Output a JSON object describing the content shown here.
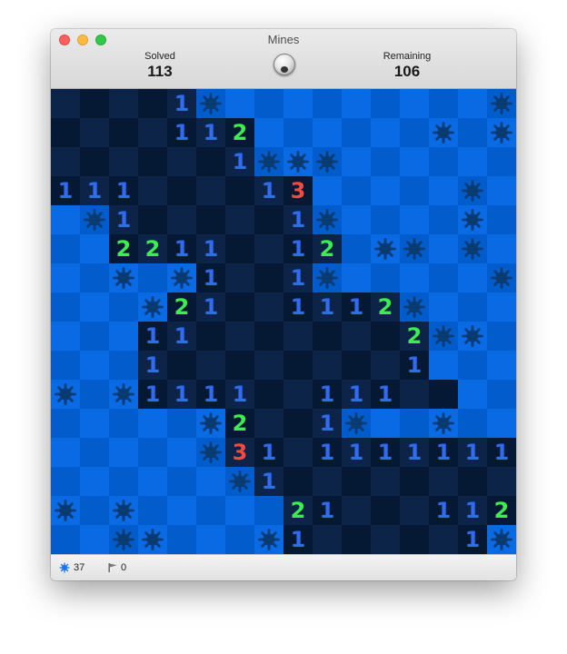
{
  "window": {
    "title": "Mines"
  },
  "header": {
    "solved_label": "Solved",
    "solved_value": "113",
    "remaining_label": "Remaining",
    "remaining_value": "106"
  },
  "status": {
    "mines": "37",
    "flags": "0"
  },
  "colors": {
    "covered_light": "#0a6ae3",
    "covered_dark": "#035ccb",
    "open_light": "#0b2447",
    "open_dark": "#051935",
    "mine": "#0a3c73",
    "number_1": "#2f6cf0",
    "number_2": "#3ded4f",
    "number_3": "#f44a42"
  },
  "board": {
    "rows": 16,
    "cols": 16,
    "legend": {
      ".": "covered",
      "*": "covered-mine",
      "0": "open-empty",
      "1-8": "open-number"
    },
    "cells": [
      "00001*.........*",
      "0000112......*.*",
      "0000001***......",
      "111000013.....*.",
      ".*1000001*....*.",
      "..22110012.**.*.",
      "..*.*1001*.....*",
      "...*21001112*...",
      "...1100000002**.",
      "...1000000001...",
      "*.*11110011100..",
      ".....*2001*..*..",
      ".....*31011111110",
      "......*1000000001",
      "*.*.....21000112*",
      "..**...*1000001*."
    ]
  }
}
